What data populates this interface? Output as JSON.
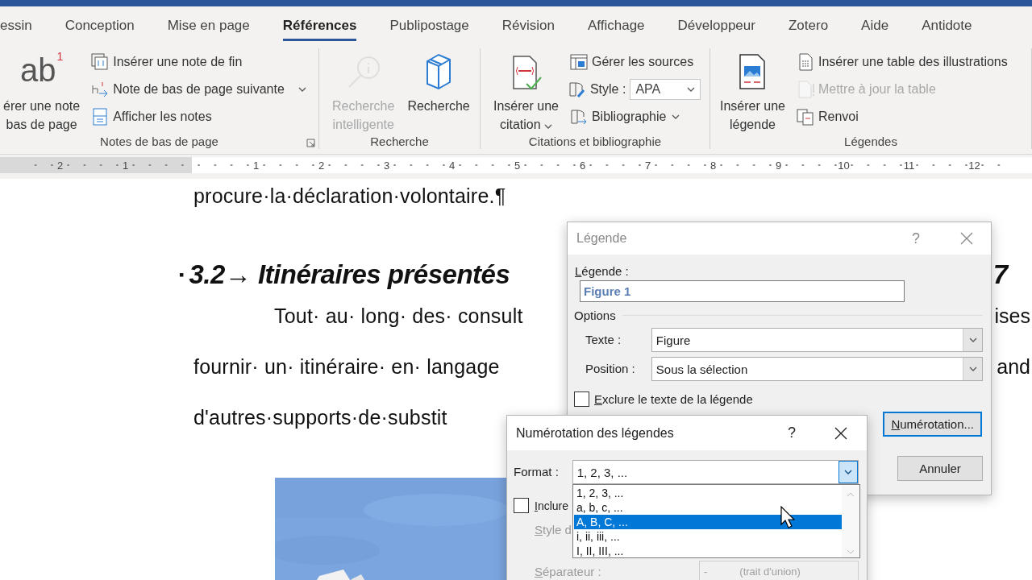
{
  "ribbon_tabs": [
    {
      "label": "essin",
      "selected": false
    },
    {
      "label": "Conception",
      "selected": false
    },
    {
      "label": "Mise en page",
      "selected": false
    },
    {
      "label": "Références",
      "selected": true
    },
    {
      "label": "Publipostage",
      "selected": false
    },
    {
      "label": "Révision",
      "selected": false
    },
    {
      "label": "Affichage",
      "selected": false
    },
    {
      "label": "Développeur",
      "selected": false
    },
    {
      "label": "Zotero",
      "selected": false
    },
    {
      "label": "Aide",
      "selected": false
    },
    {
      "label": "Antidote",
      "selected": false
    }
  ],
  "ribbon_groups": [
    {
      "label": "Notes de bas de page",
      "launcher": true,
      "large_buttons": [
        {
          "glyph": "ab",
          "glyph_mark": "1",
          "lines": [
            "érer une note",
            "bas de page"
          ],
          "disabled": false
        }
      ],
      "small_buttons": [
        {
          "kind": "button",
          "label": "Insérer une note de fin",
          "disabled": false
        },
        {
          "kind": "button",
          "label": "Note de bas de page suivante",
          "disabled": false,
          "dropdown": true
        },
        {
          "kind": "button",
          "label": "Afficher les notes",
          "disabled": false
        }
      ]
    },
    {
      "label": "Recherche",
      "large_buttons": [
        {
          "lines": [
            "Recherche",
            "intelligente"
          ],
          "disabled": true
        },
        {
          "lines": [
            "Recherche"
          ],
          "disabled": false
        }
      ]
    },
    {
      "label": "Citations et bibliographie",
      "large_buttons": [
        {
          "lines": [
            "Insérer une",
            "citation"
          ],
          "disabled": false,
          "dropdown": true
        }
      ],
      "small_buttons": [
        {
          "kind": "button",
          "label": "Gérer les sources",
          "disabled": false
        },
        {
          "kind": "select",
          "label": "Style :",
          "value": "APA"
        },
        {
          "kind": "button",
          "label": "Bibliographie",
          "disabled": false,
          "dropdown": true
        }
      ]
    },
    {
      "label": "Légendes",
      "large_buttons": [
        {
          "lines": [
            "Insérer une",
            "légende"
          ],
          "disabled": false
        }
      ],
      "small_buttons": [
        {
          "kind": "button",
          "label": "Insérer une table des illustrations",
          "disabled": false
        },
        {
          "kind": "button",
          "label": "Mettre à jour la table",
          "disabled": true
        },
        {
          "kind": "button",
          "label": "Renvoi",
          "disabled": false
        }
      ]
    }
  ],
  "ruler": {
    "left_numbers": [
      "2",
      "1"
    ],
    "right_numbers": [
      "1",
      "2",
      "3",
      "4",
      "5",
      "6",
      "7",
      "8",
      "9",
      "10",
      "11",
      "12"
    ]
  },
  "document": {
    "first_line": "procure·la·déclaration·volontaire.¶",
    "heading": {
      "bullet": "▪",
      "text": "3.2→ Itinéraires présentés",
      "tail": "7"
    },
    "body_lines": [
      {
        "text": "Tout· au· long· des· consult",
        "tail": "ises"
      },
      {
        "text": "fournir· un· itinéraire· en· langage",
        "tail": "and"
      },
      {
        "text": "d'autres·supports·de·substit"
      }
    ]
  },
  "caption_dialog": {
    "title": "Légende",
    "help": "?",
    "caption_label": "Légende :",
    "caption_value": "Figure 1",
    "options_label": "Options",
    "selects": [
      {
        "label": "Texte :",
        "value": "Figure"
      },
      {
        "label": "Position :",
        "value": "Sous la sélection"
      }
    ],
    "exclude": {
      "label": "Exclure le texte de la légende",
      "checked": false
    },
    "buttons": [
      {
        "label": "Numérotation...",
        "focused": true
      },
      {
        "label": "Annuler",
        "focused": false
      }
    ]
  },
  "numbering_dialog": {
    "title": "Numérotation des légendes",
    "help": "?",
    "format_label": "Format :",
    "format_value": "1, 2, 3, ...",
    "open": true,
    "options": [
      {
        "label": "1, 2, 3, ...",
        "selected": false
      },
      {
        "label": "a, b, c, ...",
        "selected": false
      },
      {
        "label": "A, B, C, ...",
        "selected": true
      },
      {
        "label": "i, ii, iii, ...",
        "selected": false
      },
      {
        "label": "I, II, III, ...",
        "selected": false
      }
    ],
    "include": {
      "label": "Inclure",
      "checked": false
    },
    "chapter": {
      "disabled": true,
      "style_label": "Style d",
      "separator_label": "Séparateur :",
      "separator_value": "-",
      "separator_desc": "(trait d'union)"
    }
  }
}
